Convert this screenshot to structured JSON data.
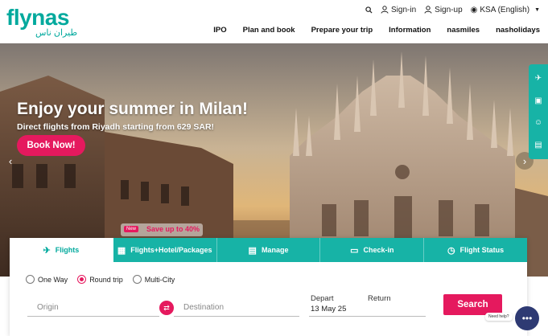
{
  "brand": {
    "logo_text": "flynas",
    "logo_subtext": "طيران ناس",
    "accent": "#00a99d",
    "cta": "#e5195e"
  },
  "top_util": {
    "search_icon": "search-icon",
    "signin_label": "Sign-in",
    "signup_label": "Sign-up",
    "locale_label": "KSA (English)"
  },
  "nav": {
    "items": [
      {
        "label": "IPO"
      },
      {
        "label": "Plan and book"
      },
      {
        "label": "Prepare your trip"
      },
      {
        "label": "Information"
      },
      {
        "label": "nasmiles"
      },
      {
        "label": "nasholidays"
      }
    ]
  },
  "hero": {
    "title": "Enjoy your summer in Milan!",
    "subtitle": "Direct flights from Riyadh starting from 629 SAR!",
    "cta_label": "Book Now!",
    "prev_icon": "‹",
    "next_icon": "›"
  },
  "promo": {
    "new_label": "New",
    "save_label": "Save up to 40%"
  },
  "booking": {
    "tabs": [
      {
        "label": "Flights",
        "icon": "plane-icon",
        "active": true
      },
      {
        "label": "Flights+Hotel/Packages",
        "icon": "hotel-icon",
        "active": false
      },
      {
        "label": "Manage",
        "icon": "calendar-icon",
        "active": false
      },
      {
        "label": "Check-in",
        "icon": "ticket-icon",
        "active": false
      },
      {
        "label": "Flight Status",
        "icon": "clock-plane-icon",
        "active": false
      }
    ],
    "trip_types": [
      {
        "label": "One Way",
        "checked": false
      },
      {
        "label": "Round trip",
        "checked": true
      },
      {
        "label": "Multi-City",
        "checked": false
      }
    ],
    "origin_placeholder": "Origin",
    "destination_placeholder": "Destination",
    "depart_label": "Depart",
    "return_label": "Return",
    "depart_value": "13 May 25",
    "search_label": "Search"
  },
  "chat": {
    "need_help_label": "Need help?"
  }
}
